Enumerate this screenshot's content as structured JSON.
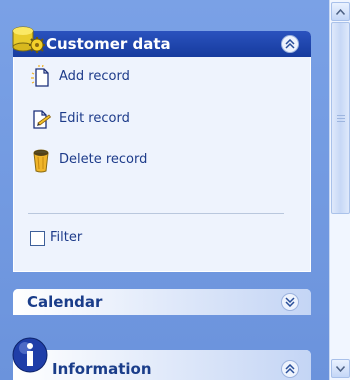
{
  "customer_group": {
    "title": "Customer data",
    "items": [
      {
        "label": "Add record",
        "icon": "add-record-icon"
      },
      {
        "label": "Edit record",
        "icon": "edit-record-icon"
      },
      {
        "label": "Delete record",
        "icon": "delete-record-icon"
      }
    ],
    "filter_label": "Filter",
    "filter_checked": false
  },
  "calendar_group": {
    "title": "Calendar"
  },
  "information_group": {
    "title": "Information"
  },
  "colors": {
    "panel_bg": "#6b93dc",
    "header_dark": "#1e46b0",
    "item_text": "#1d3b8a",
    "body_bg": "#eef3fd"
  }
}
